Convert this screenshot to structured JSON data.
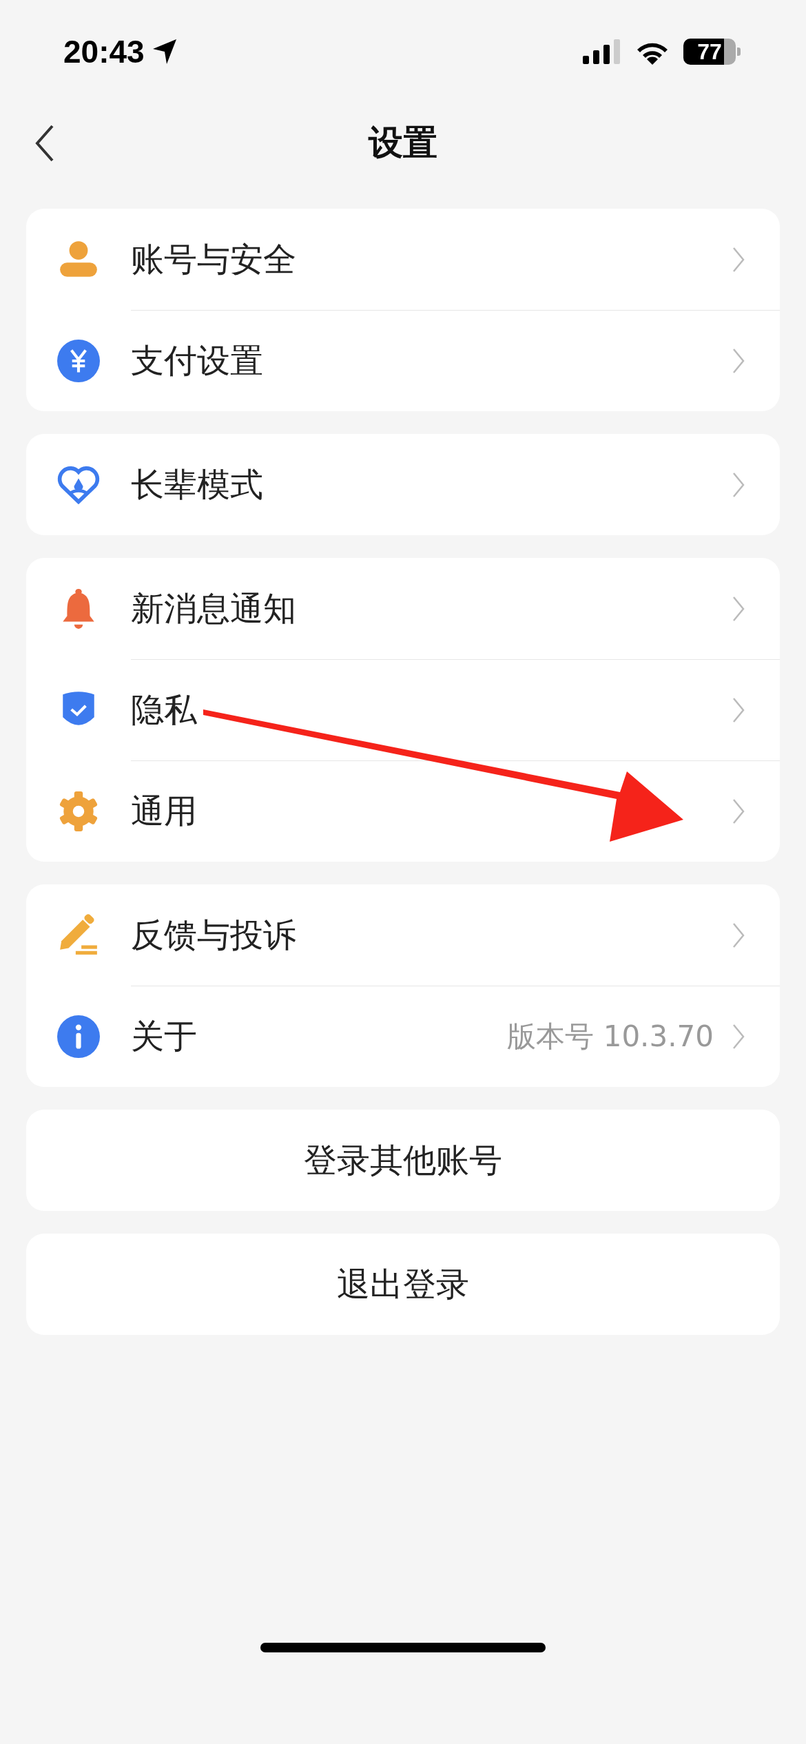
{
  "status_bar": {
    "time": "20:43",
    "battery": "77"
  },
  "nav": {
    "title": "设置"
  },
  "groups": [
    {
      "items": [
        {
          "label": "账号与安全"
        },
        {
          "label": "支付设置"
        }
      ]
    },
    {
      "items": [
        {
          "label": "长辈模式"
        }
      ]
    },
    {
      "items": [
        {
          "label": "新消息通知"
        },
        {
          "label": "隐私"
        },
        {
          "label": "通用"
        }
      ]
    },
    {
      "items": [
        {
          "label": "反馈与投诉"
        },
        {
          "label": "关于",
          "value": "版本号 10.3.70"
        }
      ]
    }
  ],
  "buttons": [
    "登录其他账号",
    "退出登录"
  ]
}
